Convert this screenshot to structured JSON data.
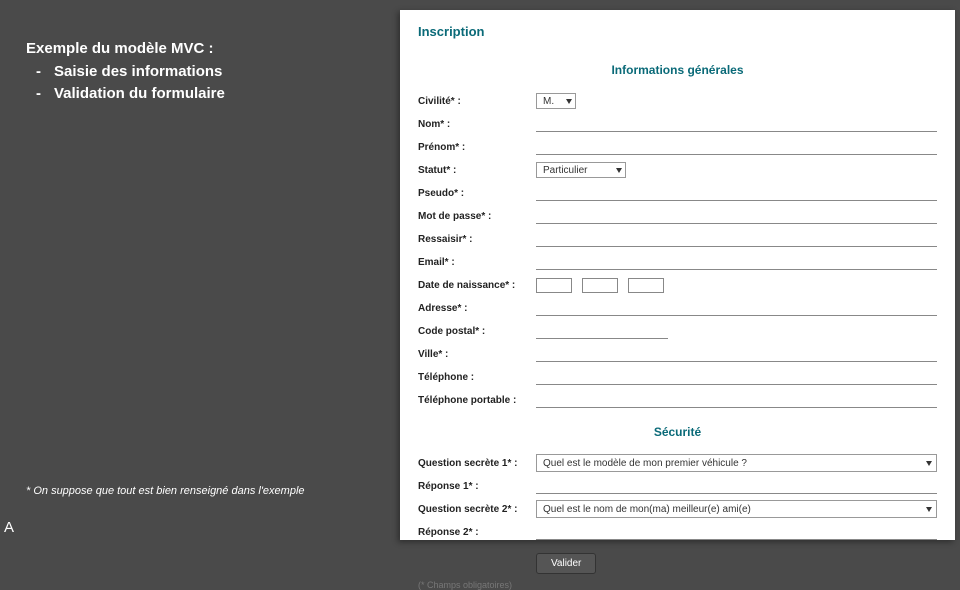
{
  "slide": {
    "title": "Exemple du modèle MVC :",
    "bullets": [
      "Saisie des informations",
      "Validation du formulaire"
    ],
    "note": "* On suppose que tout est bien renseigné dans l'exemple",
    "corner": "A"
  },
  "form": {
    "page_title": "Inscription",
    "section1": "Informations générales",
    "section2": "Sécurité",
    "labels": {
      "civilite": "Civilité* :",
      "nom": "Nom* :",
      "prenom": "Prénom* :",
      "statut": "Statut* :",
      "pseudo": "Pseudo* :",
      "mdp": "Mot de passe* :",
      "ressaisir": "Ressaisir* :",
      "email": "Email* :",
      "dob": "Date de naissance* :",
      "adresse": "Adresse* :",
      "cp": "Code postal* :",
      "ville": "Ville* :",
      "tel": "Téléphone :",
      "telp": "Téléphone portable :",
      "q1": "Question secrète 1* :",
      "r1": "Réponse 1* :",
      "q2": "Question secrète 2* :",
      "r2": "Réponse 2* :"
    },
    "values": {
      "civilite_selected": "M.",
      "statut_selected": "Particulier",
      "q1_selected": "Quel est le modèle de mon premier véhicule ?",
      "q2_selected": "Quel est le nom de mon(ma) meilleur(e) ami(e)"
    },
    "validate": "Valider",
    "obligatory": "(* Champs obligatoires)"
  }
}
